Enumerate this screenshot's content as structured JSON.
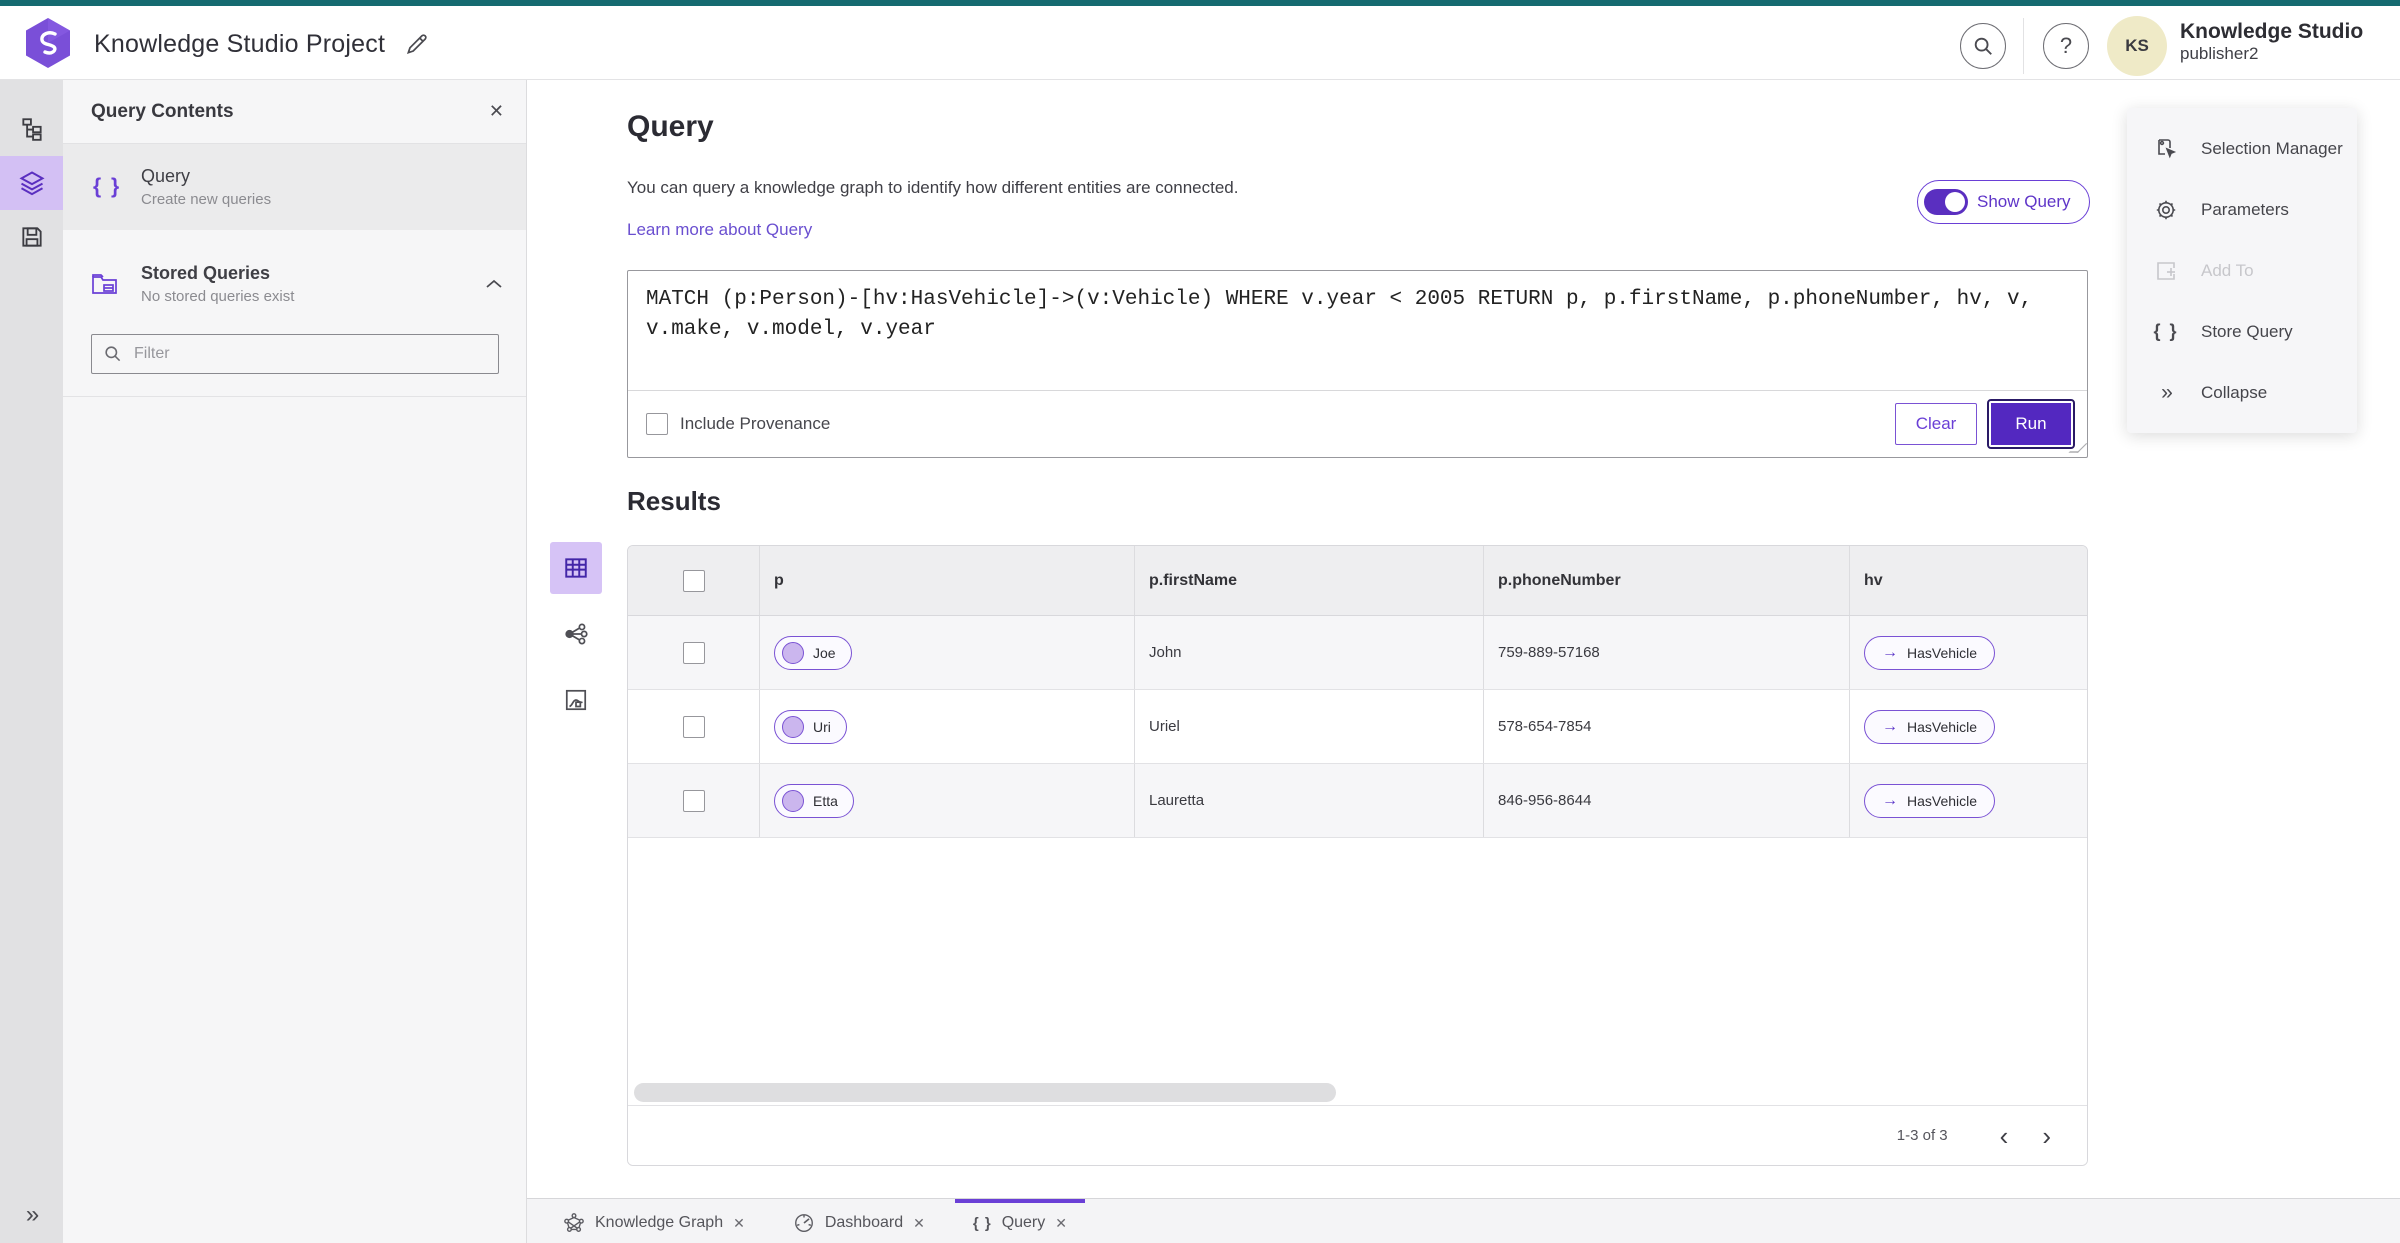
{
  "header": {
    "title": "Knowledge Studio Project",
    "product_name": "Knowledge Studio",
    "user_name": "publisher2",
    "avatar_initials": "KS"
  },
  "sidebar": {
    "panel_title": "Query Contents",
    "query_item": {
      "label": "Query",
      "sublabel": "Create new queries"
    },
    "stored_item": {
      "label": "Stored Queries",
      "sublabel": "No stored queries exist"
    },
    "filter_placeholder": "Filter"
  },
  "query_section": {
    "title": "Query",
    "description": "You can query a knowledge graph to identify how different entities are connected.",
    "link": "Learn more about Query",
    "show_query_label": "Show Query",
    "query_text": "MATCH (p:Person)-[hv:HasVehicle]->(v:Vehicle) WHERE v.year < 2005 RETURN p, p.firstName, p.phoneNumber, hv, v, v.make, v.model, v.year",
    "include_provenance_label": "Include Provenance",
    "clear_label": "Clear",
    "run_label": "Run"
  },
  "results": {
    "title": "Results",
    "columns": [
      "p",
      "p.firstName",
      "p.phoneNumber",
      "hv"
    ],
    "rows": [
      {
        "p": "Joe",
        "firstName": "John",
        "phoneNumber": "759-889-57168",
        "hv": "HasVehicle"
      },
      {
        "p": "Uri",
        "firstName": "Uriel",
        "phoneNumber": "578-654-7854",
        "hv": "HasVehicle"
      },
      {
        "p": "Etta",
        "firstName": "Lauretta",
        "phoneNumber": "846-956-8644",
        "hv": "HasVehicle"
      }
    ],
    "pagination": "1-3 of 3"
  },
  "context_menu": {
    "items": [
      {
        "label": "Selection Manager"
      },
      {
        "label": "Parameters"
      },
      {
        "label": "Add To"
      },
      {
        "label": "Store Query"
      },
      {
        "label": "Collapse"
      }
    ]
  },
  "tabs": [
    {
      "label": "Knowledge Graph"
    },
    {
      "label": "Dashboard"
    },
    {
      "label": "Query"
    }
  ],
  "icons": {
    "braces": "{ }",
    "close": "✕",
    "arrow_right": "→",
    "double_chevron_right": "»",
    "chevron_left": "‹",
    "chevron_right": "›"
  },
  "colors": {
    "top_strip": "#156a70",
    "accent_purple": "#5a2fc0",
    "run_button": "#5328c0",
    "rail_selected_bg": "#d3c0f4",
    "chip_border": "#7a52d4",
    "chip_dot_fill": "#cbb6ee",
    "panel_bg": "#f6f6f7",
    "table_header_bg": "#eeeef0",
    "striped_row_bg": "#f6f6f8",
    "avatar_bg": "#efeac7",
    "link": "#6a4fd0"
  }
}
